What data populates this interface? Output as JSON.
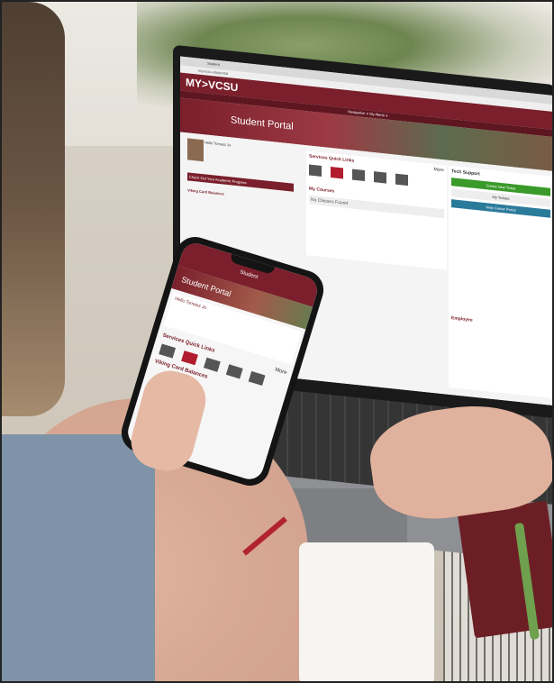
{
  "laptop": {
    "tab_title": "Student",
    "address": "my.vcsu.edu/portal",
    "brand": "MY>VCSU",
    "nav": "Navigation ∨     My Alerts ∨",
    "hero_title": "Student Portal",
    "profile": "Hello Tomasz Jo",
    "progress_button": "Check Out Your Academic Progress",
    "card_balances": "Viking Card Balances",
    "quick_links": "Services Quick Links",
    "quick_links_more": "More",
    "courses": "My Courses",
    "no_classes": "No Classes Found",
    "tech_support": "Tech Support",
    "new_ticket": "Create New Ticket",
    "my_tickets": "My Tickets",
    "help_center": "Help Center Portal",
    "employee": "Employee"
  },
  "phone": {
    "header": "Student",
    "hero_title": "Student Portal",
    "profile": "Hello Tomasz Jo",
    "quick_links": "Services Quick Links",
    "more": "More",
    "card_balances": "Viking Card Balances"
  },
  "colors": {
    "brand": "#7a1f2b",
    "accent_green": "#3a9a2a",
    "accent_blue": "#2a7a9a"
  }
}
